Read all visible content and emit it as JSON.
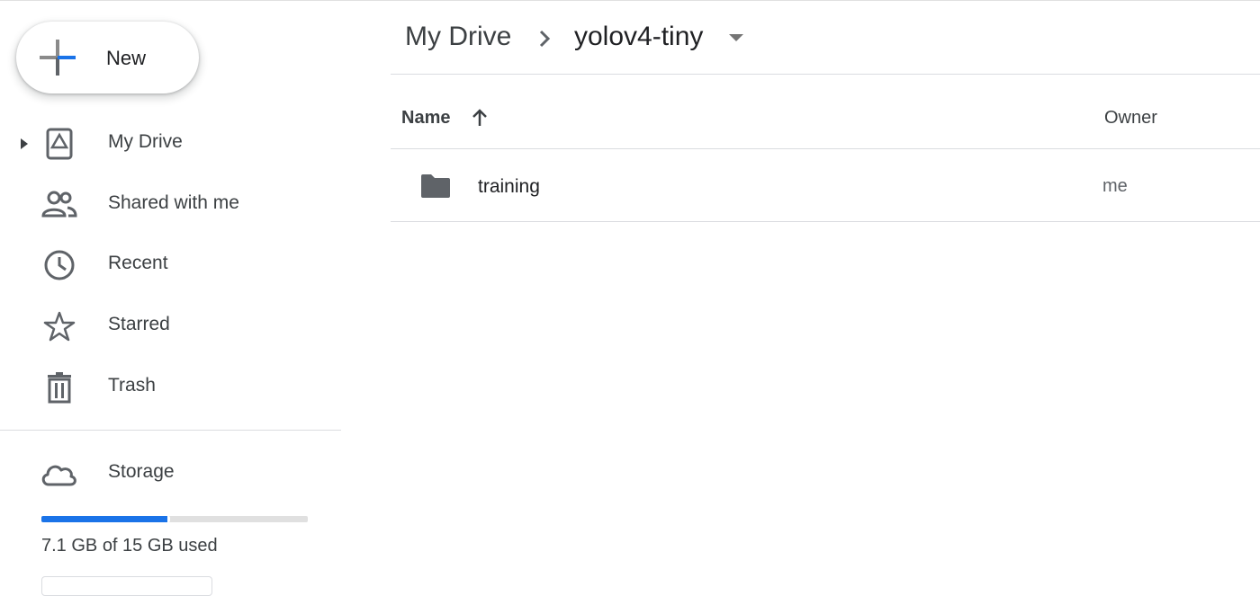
{
  "sidebar": {
    "new_label": "New",
    "items": [
      {
        "label": "My Drive",
        "icon": "my-drive-icon"
      },
      {
        "label": "Shared with me",
        "icon": "people-icon"
      },
      {
        "label": "Recent",
        "icon": "clock-icon"
      },
      {
        "label": "Starred",
        "icon": "star-icon"
      },
      {
        "label": "Trash",
        "icon": "trash-icon"
      }
    ],
    "storage": {
      "label": "Storage",
      "icon": "cloud-icon",
      "used_text": "7.1 GB of 15 GB used",
      "used_fraction": 0.473
    }
  },
  "breadcrumb": {
    "root": "My Drive",
    "current": "yolov4-tiny"
  },
  "file_list": {
    "columns": {
      "name": "Name",
      "owner": "Owner"
    },
    "rows": [
      {
        "name": "training",
        "owner": "me",
        "type": "folder"
      }
    ]
  },
  "colors": {
    "accent": "#1a73e8",
    "text": "#3c4043",
    "icon": "#5f6368"
  }
}
